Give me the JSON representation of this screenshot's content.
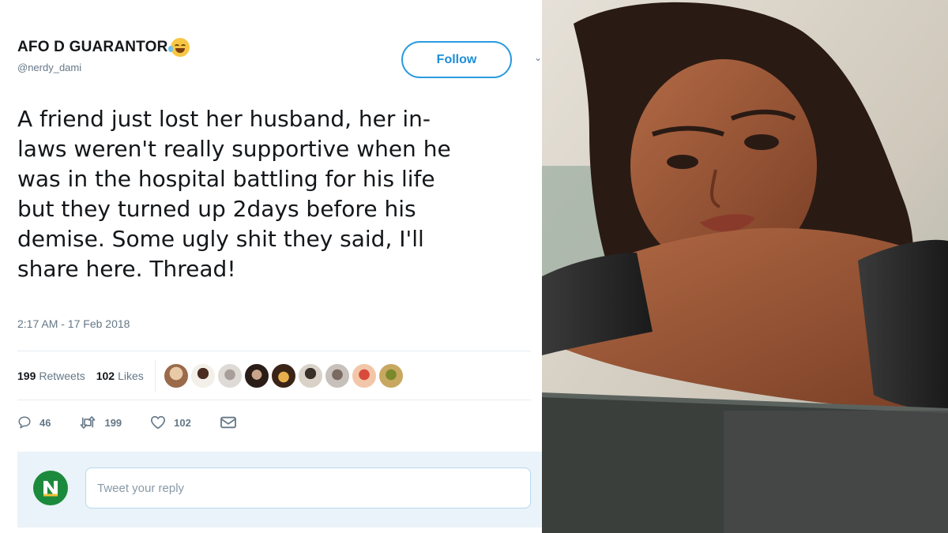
{
  "tweet": {
    "display_name": "AFO D GUARANTOR",
    "handle": "@nerdy_dami",
    "follow_label": "Follow",
    "text_lines": [
      "A friend just lost her husband, her in-",
      "laws weren't really supportive when he",
      "was in the hospital battling for his life",
      "but they turned up 2days before his",
      "demise. Some ugly shit they said, I'll",
      "share here. Thread!"
    ],
    "timestamp": "2:17 AM - 17 Feb 2018",
    "stats": {
      "retweets_count": "199",
      "retweets_label": "Retweets",
      "likes_count": "102",
      "likes_label": "Likes"
    },
    "actions": {
      "replies": "46",
      "retweets": "199",
      "likes": "102"
    },
    "reply": {
      "placeholder": "Tweet your reply"
    },
    "icons": [
      "tears-of-joy-emoji-icon",
      "caret-down-icon",
      "reply-icon",
      "retweet-icon",
      "heart-icon",
      "mail-icon"
    ],
    "colors": {
      "accent": "#1d8ed8",
      "text": "#14171a",
      "muted": "#657786",
      "reply_bg": "#eaf3f9",
      "reply_avatar": "#1c8a3c"
    }
  }
}
